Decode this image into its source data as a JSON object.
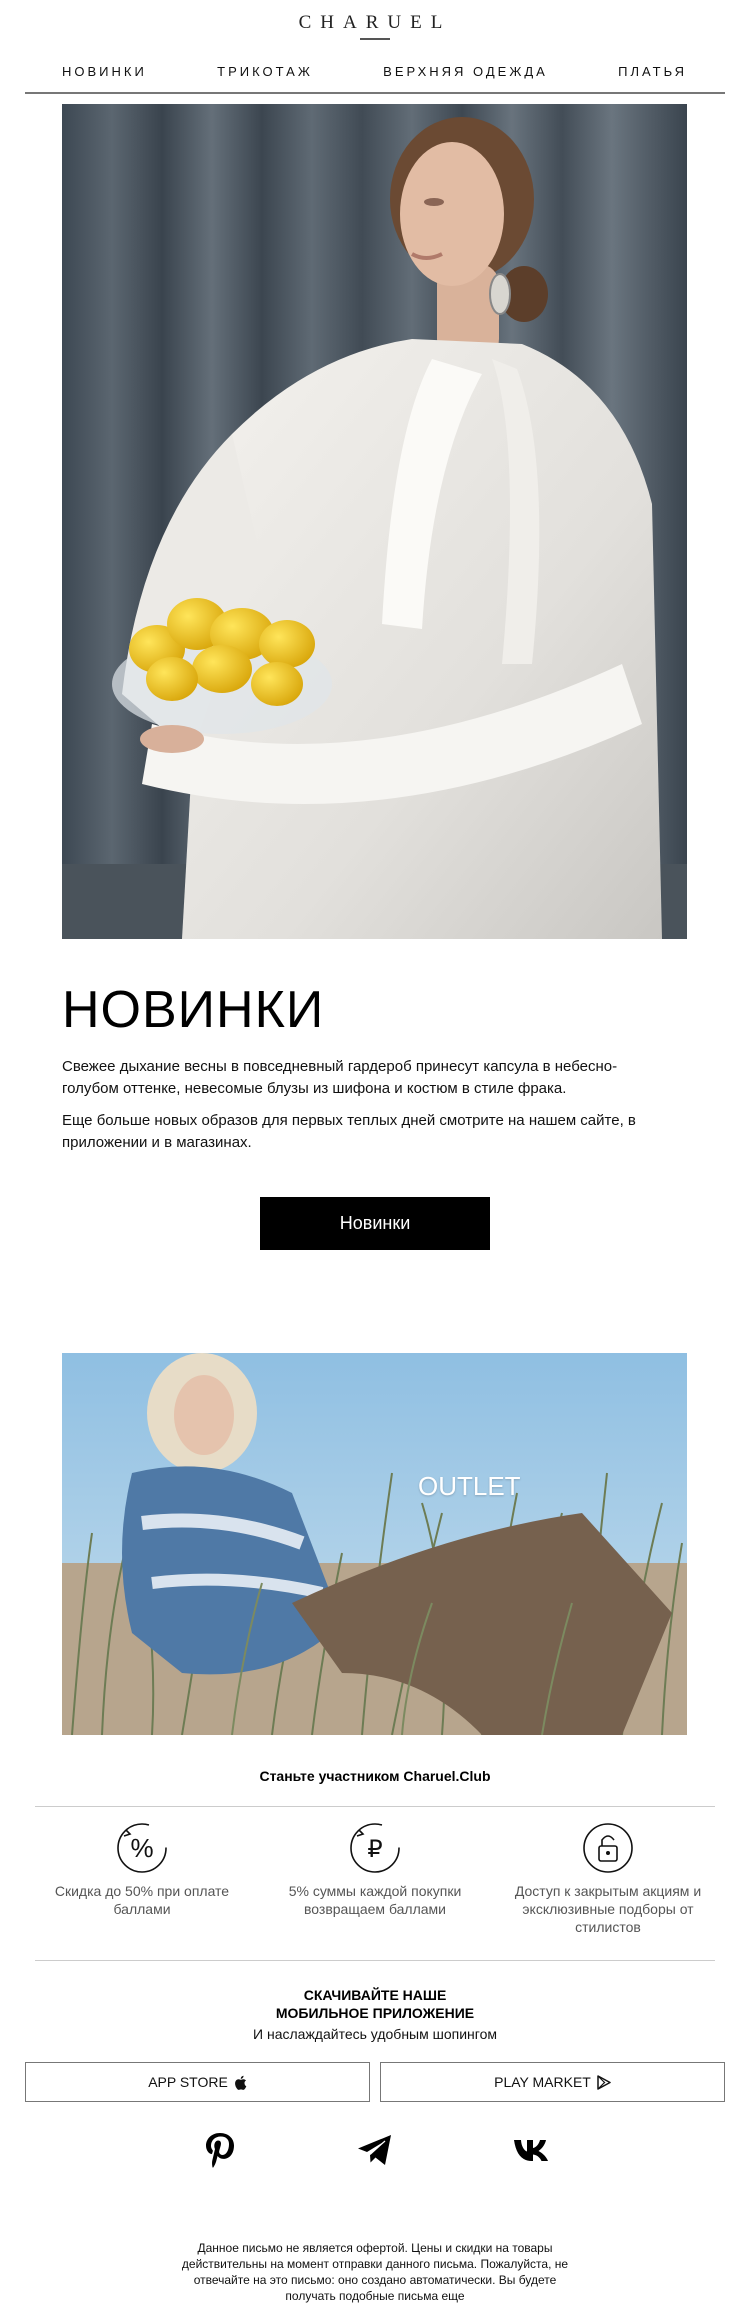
{
  "brand": {
    "logo": "CHARUEL"
  },
  "nav": {
    "items": [
      "НОВИНКИ",
      "ТРИКОТАЖ",
      "ВЕРХНЯЯ ОДЕЖДА",
      "ПЛАТЬЯ"
    ]
  },
  "new": {
    "title": "НОВИНКИ",
    "paragraph1": "Свежее дыхание весны в повседневный гардероб принесут капсула в небесно-голубом оттенке, невесомые блузы из шифона и костюм в стиле фрака.",
    "paragraph2": "Еще больше новых образов для первых теплых дней смотрите на нашем сайте, в приложении и в магазинах.",
    "button_label": "Новинки"
  },
  "outlet": {
    "label": "OUTLET"
  },
  "club": {
    "title": "Станьте участником Charuel.Club",
    "perks": [
      {
        "icon": "percent-icon",
        "text": "Скидка до 50% при оплате баллами"
      },
      {
        "icon": "ruble-icon",
        "text": "5% суммы каждой покупки возвращаем баллами"
      },
      {
        "icon": "lock-icon",
        "text": "Доступ к закрытым акциям и эксклюзивные подборы от стилистов"
      }
    ]
  },
  "app": {
    "title_line1": "СКАЧИВАЙТЕ НАШЕ",
    "title_line2": "МОБИЛЬНОЕ ПРИЛОЖЕНИЕ",
    "subtitle": "И наслаждайтесь удобным шопингом",
    "app_store_label": "APP STORE",
    "play_market_label": "PLAY MARKET"
  },
  "social": [
    "pinterest-icon",
    "telegram-icon",
    "vk-icon"
  ],
  "footer": {
    "disclaimer": "Данное письмо не является офертой. Цены и скидки на товары действительны на момент отправки данного письма. Пожалуйста, не отвечайте на это письмо: оно создано автоматически. Вы будете получать подобные письма еще"
  }
}
